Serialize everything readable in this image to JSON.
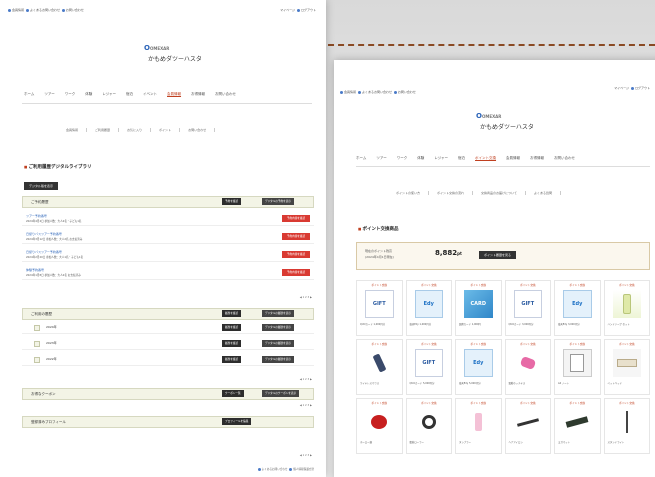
{
  "left": {
    "util_links": [
      "会員情報",
      "よくあるお問い合わせ",
      "お問い合わせ"
    ],
    "util_links_right": [
      "マイページ",
      "ログアウト"
    ],
    "brand_line1": "O",
    "brand_line1b": "OMEXAR",
    "brand_name": "かもめダツーハスタ",
    "nav": [
      "ホーム",
      "ツアー",
      "ワーク",
      "体験",
      "レジャー",
      "宿泊",
      "イベント",
      "会員情報",
      "お得情報",
      "お問い合わせ"
    ],
    "nav_active_index": 7,
    "subnav": [
      "会員情報",
      "ご利用履歴",
      "お気に入り",
      "ポイント",
      "お問い合わせ"
    ],
    "section_title": "ご利用履歴デジタルライブラリ",
    "filter_button": "デジタル版を表示",
    "group1": {
      "title": "ご予約履歴",
      "btn1": "予約を確認",
      "btn2": "デジタルの予約を表示"
    },
    "rows": [
      {
        "title": "ツアー予約番号",
        "detail": "2024年4月4日 参加人数：大人2名・子ども1名",
        "button": "予約内容を確認"
      },
      {
        "title": "日帰りバスツアー予約番号",
        "detail": "2024年3月12日 参加人数：大人2名 お支払済み",
        "button": "予約内容を確認"
      },
      {
        "title": "日帰りバスツアー予約番号",
        "detail": "2024年2月20日 参加人数：大人1名・子ども1名",
        "button": "予約内容を確認"
      },
      {
        "title": "体験予約番号",
        "detail": "2024年1月8日 参加人数：大人2名 お支払済み",
        "button": "予約内容を確認"
      }
    ],
    "pager1": "◀ 1 2 3 ▶",
    "group2": {
      "title": "ご利用の履歴",
      "btn1": "履歴を確認",
      "btn2": "デジタルの履歴を表示"
    },
    "sub_rows": [
      "2024年",
      "2023年",
      "2022年"
    ],
    "pager2": "◀ 1 2 3 ▶",
    "group3": {
      "title": "お得なクーポン",
      "btn1": "クーポン一覧",
      "btn2": "デジタルのクーポンを表示"
    },
    "pager3": "◀ 1 2 3 ▶",
    "group4": {
      "title": "登録済みプロフィール",
      "btn1": "プロフィールを編集"
    },
    "pager4": "◀ 1 2 3 ▶",
    "footer": [
      "よくあるお問い合わせ",
      "個人情報保護方針"
    ]
  },
  "right": {
    "util_links": [
      "会員情報",
      "よくあるお問い合わせ",
      "お問い合わせ"
    ],
    "util_links_right": [
      "マイページ",
      "ログアウト"
    ],
    "brand_line1b": "OMEXAR",
    "brand_name": "かもめダツーハスタ",
    "nav": [
      "ホーム",
      "ツアー",
      "ワーク",
      "体験",
      "レジャー",
      "宿泊",
      "ポイント交換",
      "会員情報",
      "お得情報",
      "お問い合わせ"
    ],
    "nav_active_index": 6,
    "subnav": [
      "ポイントの使い方",
      "ポイント交換の流れ",
      "交換商品のお届けについて",
      "よくある質問"
    ],
    "section_title": "ポイント交換商品",
    "points_label1": "現在のポイント残高",
    "points_label2": "(2024年4月1日現在)",
    "points_value": "8,882",
    "points_unit": "pt",
    "points_button": "ポイント履歴を見る",
    "products": [
      {
        "tag": "ポイント交換",
        "thumb": "GIFT",
        "style": "thumb-gift",
        "name": "QUOカード 1,000円分"
      },
      {
        "tag": "ポイント交換",
        "thumb": "Edy",
        "style": "thumb-edy",
        "name": "楽天Edy 1,000円分"
      },
      {
        "tag": "ポイント交換",
        "thumb": "CARD",
        "style": "thumb-cards",
        "name": "図書カード 1,000円"
      },
      {
        "tag": "ポイント交換",
        "thumb": "GIFT",
        "style": "thumb-gift",
        "name": "QUOカード 3,000円分"
      },
      {
        "tag": "ポイント交換",
        "thumb": "Edy",
        "style": "thumb-edy",
        "name": "楽天Edy 3,000円分"
      },
      {
        "tag": "ポイント交換",
        "thumb": "",
        "style": "thumb-bottle",
        "shape": "shape-bottle",
        "name": "ハンドソープ セット"
      },
      {
        "tag": "ポイント交換",
        "thumb": "",
        "style": "thumb-phone",
        "shape": "shape-phone",
        "name": "ワイヤレスマウス"
      },
      {
        "tag": "ポイント交換",
        "thumb": "GIFT",
        "style": "thumb-gift",
        "name": "QUOカード 5,000円分"
      },
      {
        "tag": "ポイント交換",
        "thumb": "Edy",
        "style": "thumb-edy",
        "name": "楽天Edy 5,000円分"
      },
      {
        "tag": "ポイント交換",
        "thumb": "",
        "style": "thumb-pink",
        "shape": "shape-pink",
        "name": "電動ホッチキス"
      },
      {
        "tag": "ポイント交換",
        "thumb": "",
        "style": "thumb-book",
        "shape": "shape-book",
        "name": "A4 ノート"
      },
      {
        "tag": "ポイント交換",
        "thumb": "",
        "style": "thumb-bed",
        "shape": "shape-bed",
        "name": "ペットベッド"
      },
      {
        "tag": "ポイント交換",
        "thumb": "",
        "style": "thumb-pot",
        "shape": "shape-pot",
        "name": "ホーロー鍋"
      },
      {
        "tag": "ポイント交換",
        "thumb": "",
        "style": "thumb-wheel",
        "shape": "shape-wheel",
        "name": "腹筋ローラー"
      },
      {
        "tag": "ポイント交換",
        "thumb": "",
        "style": "thumb-glass",
        "shape": "shape-glass",
        "name": "タンブラー"
      },
      {
        "tag": "ポイント交換",
        "thumb": "",
        "style": "thumb-tool",
        "shape": "shape-tool",
        "name": "ヘアアイロン"
      },
      {
        "tag": "ポイント交換",
        "thumb": "",
        "style": "thumb-mat",
        "shape": "shape-mat",
        "name": "ヨガマット"
      },
      {
        "tag": "ポイント交換",
        "thumb": "",
        "style": "thumb-stand",
        "shape": "shape-stand",
        "name": "スタンドライト"
      }
    ]
  }
}
